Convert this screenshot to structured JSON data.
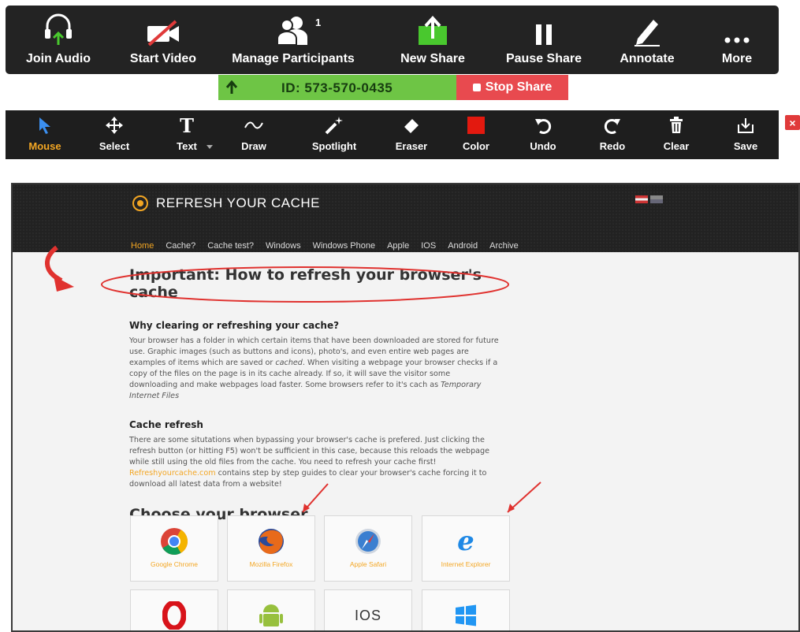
{
  "meeting_toolbar": {
    "items": [
      {
        "label": "Join Audio",
        "icon": "headphones-icon"
      },
      {
        "label": "Start Video",
        "icon": "video-off-icon"
      },
      {
        "label": "Manage Participants",
        "icon": "participants-icon",
        "badge": "1"
      },
      {
        "label": "New Share",
        "icon": "share-screen-icon"
      },
      {
        "label": "Pause Share",
        "icon": "pause-icon"
      },
      {
        "label": "Annotate",
        "icon": "pencil-icon"
      },
      {
        "label": "More",
        "icon": "more-dots-icon"
      }
    ]
  },
  "share_status": {
    "meeting_id": "ID: 573-570-0435",
    "stop_label": "Stop Share"
  },
  "annotate_toolbar": {
    "items": [
      {
        "label": "Mouse",
        "icon": "cursor-arrow-icon",
        "active": true
      },
      {
        "label": "Select",
        "icon": "move-arrows-icon"
      },
      {
        "label": "Text",
        "icon": "text-t-icon"
      },
      {
        "label": "Draw",
        "icon": "squiggle-icon"
      },
      {
        "label": "Spotlight",
        "icon": "spotlight-wand-icon"
      },
      {
        "label": "Eraser",
        "icon": "eraser-icon"
      },
      {
        "label": "Color",
        "icon": "color-swatch-icon"
      },
      {
        "label": "Undo",
        "icon": "undo-icon"
      },
      {
        "label": "Redo",
        "icon": "redo-icon"
      },
      {
        "label": "Clear",
        "icon": "trash-icon"
      },
      {
        "label": "Save",
        "icon": "save-download-icon"
      }
    ],
    "close_label": "×"
  },
  "website": {
    "logo_text": "REFRESH YOUR CACHE",
    "nav": [
      "Home",
      "Cache?",
      "Cache test?",
      "Windows",
      "Windows Phone",
      "Apple",
      "IOS",
      "Android",
      "Archive"
    ],
    "heading": "Important: How to refresh your browser's cache",
    "why_title": "Why clearing or refreshing your cache?",
    "why_body_1": "Your browser has a folder in which certain items that have been downloaded are stored for future use. Graphic images (such as buttons and icons), photo's, and even entire web pages are examples of items which are saved or ",
    "why_body_em": "cached",
    "why_body_2": ". When visiting a webpage your browser checks if a copy of the files on the page is in its cache already. If so, it will save the visitor some downloading and make webpages load faster. Some browsers refer to it's cach as ",
    "why_body_em2": "Temporary Internet Files",
    "refresh_title": "Cache refresh",
    "refresh_body_1": "There are some situtations when bypassing your browser's cache is prefered. Just clicking the refresh button (or hitting F5) won't be sufficient in this case, because this reloads the webpage while still using the old files from the cache. You need to refresh your cache first!",
    "refresh_link": "Refreshyourcache.com",
    "refresh_body_2": " contains step by step guides to clear your browser's cache forcing it to download all latest data from a website!",
    "choose_heading": "Choose your browser",
    "browsers": [
      {
        "name": "Google Chrome",
        "icon": "chrome-icon"
      },
      {
        "name": "Mozilla Firefox",
        "icon": "firefox-icon"
      },
      {
        "name": "Apple Safari",
        "icon": "safari-icon"
      },
      {
        "name": "Internet Explorer",
        "icon": "internet-explorer-icon"
      },
      {
        "name": "",
        "icon": "opera-icon"
      },
      {
        "name": "",
        "icon": "android-icon"
      },
      {
        "name": "",
        "icon": "ios-icon",
        "glyph": "IOS"
      },
      {
        "name": "",
        "icon": "windows-icon"
      }
    ]
  },
  "colors": {
    "toolbar_bg": "#232323",
    "share_green": "#6ec545",
    "stop_red": "#e84a4f",
    "accent_orange": "#f3a623",
    "annotation_red": "#e0322f"
  }
}
